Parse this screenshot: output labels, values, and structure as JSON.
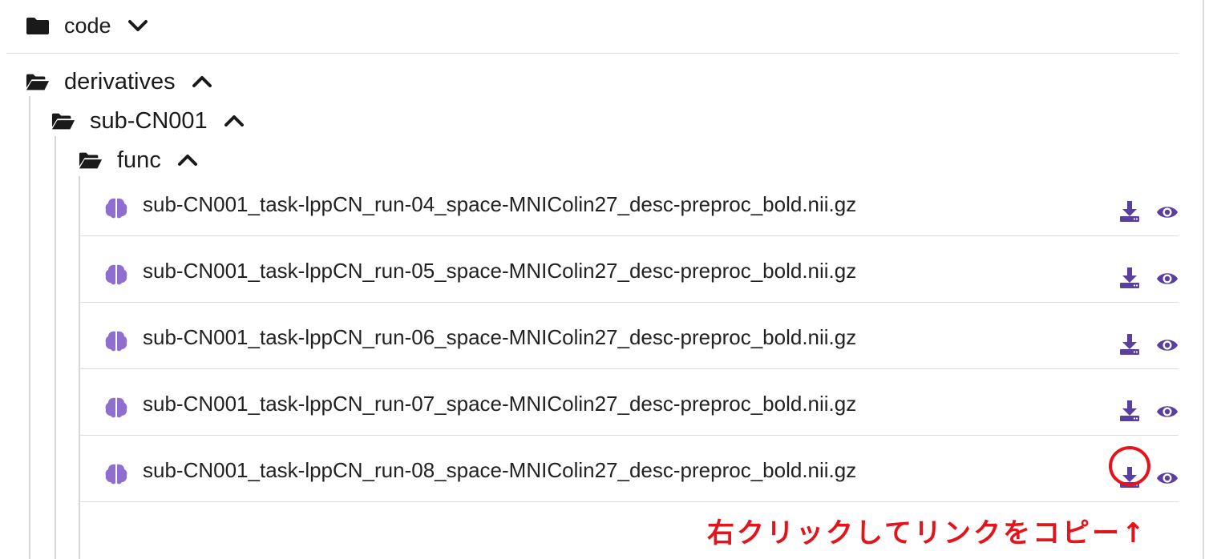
{
  "colors": {
    "accent": "#5b3fa0",
    "brain": "#8e6fcf",
    "annotation": "#e3141c"
  },
  "tree": {
    "code": {
      "label": "code",
      "icon": "folder-closed-icon",
      "toggle": "chevron-down-icon"
    },
    "derivatives": {
      "label": "derivatives",
      "icon": "folder-open-icon",
      "toggle": "chevron-up-icon"
    },
    "subject": {
      "label": "sub-CN001",
      "icon": "folder-open-icon",
      "toggle": "chevron-up-icon"
    },
    "func": {
      "label": "func",
      "icon": "folder-open-icon",
      "toggle": "chevron-up-icon"
    }
  },
  "files": [
    {
      "name": "sub-CN001_task-lppCN_run-04_space-MNIColin27_desc-preproc_bold.nii.gz",
      "icon": "brain-icon",
      "actions": [
        "download-icon",
        "eye-icon"
      ]
    },
    {
      "name": "sub-CN001_task-lppCN_run-05_space-MNIColin27_desc-preproc_bold.nii.gz",
      "icon": "brain-icon",
      "actions": [
        "download-icon",
        "eye-icon"
      ]
    },
    {
      "name": "sub-CN001_task-lppCN_run-06_space-MNIColin27_desc-preproc_bold.nii.gz",
      "icon": "brain-icon",
      "actions": [
        "download-icon",
        "eye-icon"
      ]
    },
    {
      "name": "sub-CN001_task-lppCN_run-07_space-MNIColin27_desc-preproc_bold.nii.gz",
      "icon": "brain-icon",
      "actions": [
        "download-icon",
        "eye-icon"
      ]
    },
    {
      "name": "sub-CN001_task-lppCN_run-08_space-MNIColin27_desc-preproc_bold.nii.gz",
      "icon": "brain-icon",
      "actions": [
        "download-icon",
        "eye-icon"
      ]
    }
  ],
  "annotation": {
    "text": "右クリックしてリンクをコピー↑"
  }
}
